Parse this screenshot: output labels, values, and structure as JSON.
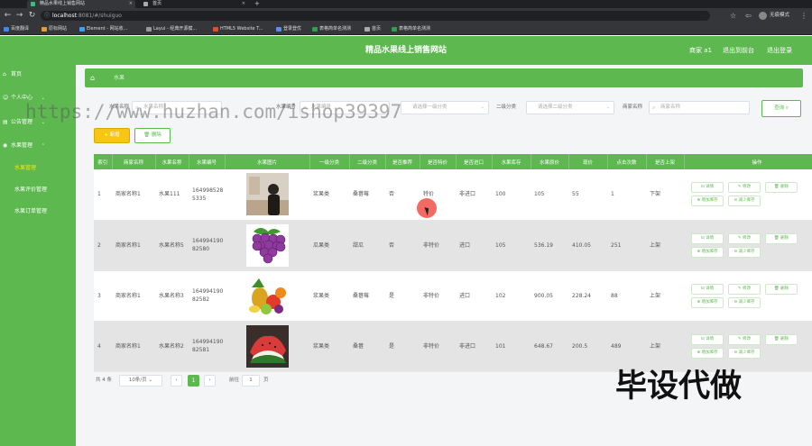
{
  "browser": {
    "tabs": [
      {
        "title": "精品水果线上销售网站",
        "active": true
      },
      {
        "title": "首页",
        "active": false
      }
    ],
    "url_host": "localhost",
    "url_path": ":8081/#/shuiguo",
    "profile_label": "无痕模式",
    "bookmarks": [
      "百度翻译",
      "原标网站",
      "Element - 网站收...",
      "Layui - 经典开源模...",
      "HTML5 Website T...",
      "登录登优",
      "表格简单名测测",
      "首页",
      "表格简单名测测"
    ]
  },
  "app": {
    "title": "精品水果线上销售网站",
    "user": "商家 a1",
    "back_link": "退出到前台",
    "logout": "退出登录"
  },
  "sidebar": {
    "items": [
      {
        "label": "首页",
        "icon": "⌂"
      },
      {
        "label": "个人中心",
        "icon": "☺"
      },
      {
        "label": "公告管理",
        "icon": "▤"
      },
      {
        "label": "水果管理",
        "icon": "◉"
      }
    ],
    "sub_items": [
      {
        "label": "水果管理",
        "active": true
      },
      {
        "label": "水果评价管理",
        "active": false
      },
      {
        "label": "水果订单管理",
        "active": false
      }
    ]
  },
  "breadcrumb": {
    "current": "水果"
  },
  "search": {
    "name_label": "水果名称",
    "name_placeholder": "水果名称",
    "code_label": "水果编号",
    "code_placeholder": "水果编号",
    "cat1_placeholder": "请选择一级分类",
    "cat2_label": "二级分类",
    "cat2_placeholder": "请选择二级分类",
    "merchant_label": "商家名称",
    "merchant_placeholder": "商家名称",
    "query_button": "查询"
  },
  "toolbar": {
    "add_label": "+ 新增",
    "delete_label": "删除"
  },
  "table": {
    "headers": [
      "索引",
      "商家名称",
      "水果名称",
      "水果编号",
      "水果图片",
      "一级分类",
      "二级分类",
      "是否推荐",
      "是否特价",
      "是否进口",
      "水果库存",
      "水果原价",
      "现价",
      "点击次数",
      "是否上架",
      "操作"
    ],
    "rows": [
      {
        "index": "1",
        "merchant": "商家名称1",
        "name": "水果111",
        "code": "1649985285335",
        "img": "photo",
        "cat1": "浆果类",
        "cat2": "桑葚莓",
        "recommend": "否",
        "special": "特价",
        "imported": "非进口",
        "stock": "100",
        "price_orig": "105",
        "price_now": "55",
        "clicks": "1",
        "onsale": "下架"
      },
      {
        "index": "2",
        "merchant": "商家名称1",
        "name": "水果名称5",
        "code": "16499419082580",
        "img": "grapes",
        "cat1": "瓜果类",
        "cat2": "甜瓜",
        "recommend": "否",
        "special": "非特价",
        "imported": "进口",
        "stock": "105",
        "price_orig": "536.19",
        "price_now": "410.05",
        "clicks": "251",
        "onsale": "上架"
      },
      {
        "index": "3",
        "merchant": "商家名称1",
        "name": "水果名称3",
        "code": "16499419082582",
        "img": "mixed",
        "cat1": "浆果类",
        "cat2": "桑葚莓",
        "recommend": "是",
        "special": "非特价",
        "imported": "进口",
        "stock": "102",
        "price_orig": "900.05",
        "price_now": "228.24",
        "clicks": "88",
        "onsale": "上架"
      },
      {
        "index": "4",
        "merchant": "商家名称1",
        "name": "水果名称2",
        "code": "16499419082581",
        "img": "watermelon",
        "cat1": "浆果类",
        "cat2": "桑葚",
        "recommend": "是",
        "special": "非特价",
        "imported": "非进口",
        "stock": "101",
        "price_orig": "648.67",
        "price_now": "200.5",
        "clicks": "489",
        "onsale": "上架"
      }
    ],
    "ops": [
      "详情",
      "修改",
      "删除",
      "增加库存",
      "减少库存"
    ]
  },
  "pager": {
    "total": "共 4 条",
    "page_size": "10条/页",
    "prev": "‹",
    "current": "1",
    "next": "›",
    "goto_label": "前往",
    "goto_value": "1",
    "page_suffix": "页"
  },
  "overlay": {
    "watermark": "https://www.huzhan.com/ishop39397",
    "stamp": "毕设代做"
  },
  "colors": {
    "primary": "#5cb84f",
    "add_button": "#f5c518"
  }
}
